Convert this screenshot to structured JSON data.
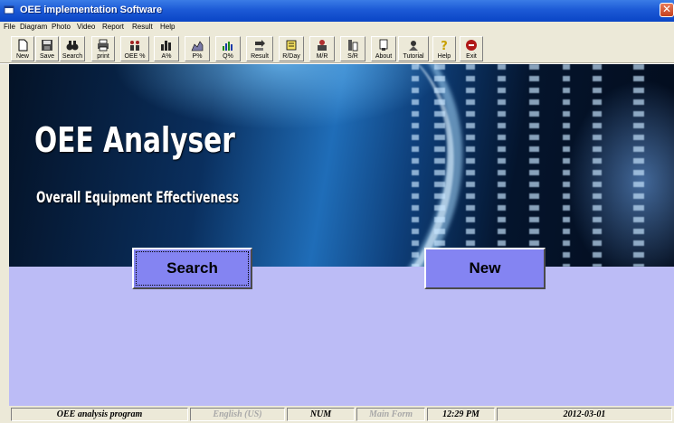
{
  "window": {
    "title": "OEE implementation Software",
    "close_glyph": "✕"
  },
  "menu": {
    "items": [
      "File",
      "Diagram",
      "Photo",
      "Video",
      "Report",
      "Result",
      "Help"
    ]
  },
  "toolbar": {
    "buttons": [
      {
        "label": "New",
        "icon": "new-document-icon"
      },
      {
        "label": "Save",
        "icon": "save-disk-icon"
      },
      {
        "label": "Search",
        "icon": "binoculars-icon"
      },
      {
        "label": "print",
        "icon": "printer-icon"
      },
      {
        "label": "OEE %",
        "icon": "people-chart-icon"
      },
      {
        "label": "A%",
        "icon": "bar-chart-icon"
      },
      {
        "label": "P%",
        "icon": "area-chart-icon"
      },
      {
        "label": "Q%",
        "icon": "column-chart-icon"
      },
      {
        "label": "Result",
        "icon": "result-arrow-icon"
      },
      {
        "label": "R/Day",
        "icon": "daily-report-icon"
      },
      {
        "label": "M/R",
        "icon": "monthly-report-icon"
      },
      {
        "label": "S/R",
        "icon": "summary-report-icon"
      },
      {
        "label": "About",
        "icon": "about-icon"
      },
      {
        "label": "Tutorial",
        "icon": "tutorial-icon"
      },
      {
        "label": "Help",
        "icon": "help-question-icon"
      },
      {
        "label": "Exit",
        "icon": "exit-icon"
      }
    ]
  },
  "banner": {
    "title": "OEE Analyser",
    "subtitle": "Overall Equipment Effectiveness"
  },
  "main": {
    "search_label": "Search",
    "new_label": "New"
  },
  "statusbar": {
    "panels": [
      "OEE analysis program",
      "English (US)",
      "NUM",
      "Main Form",
      "12:29 PM",
      "2012-03-01"
    ]
  },
  "colors": {
    "titlebar": "#0a45c6",
    "main_background": "#bcbcf6",
    "button_fill": "#8484f2",
    "chrome": "#ece9d8"
  }
}
